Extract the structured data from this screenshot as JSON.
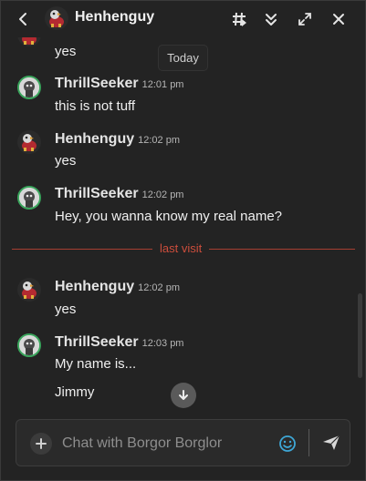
{
  "header": {
    "title": "Henhenguy",
    "back_icon": "chevron-left-icon",
    "actions": [
      "threads-icon",
      "double-chevron-down-icon",
      "expand-icon",
      "close-icon"
    ]
  },
  "date_marker": "Today",
  "top_partial_message": {
    "text": "yes"
  },
  "messages": [
    {
      "author": "ThrillSeeker",
      "time": "12:01 pm",
      "lines": [
        "this is not tuff"
      ]
    },
    {
      "author": "Henhenguy",
      "time": "12:02 pm",
      "lines": [
        "yes"
      ]
    },
    {
      "author": "ThrillSeeker",
      "time": "12:02 pm",
      "lines": [
        "Hey, you wanna know my real name?"
      ]
    },
    {
      "author": "Henhenguy",
      "time": "12:02 pm",
      "lines": [
        "yes"
      ]
    },
    {
      "author": "ThrillSeeker",
      "time": "12:03 pm",
      "lines": [
        "My name is...",
        "Jimmy"
      ]
    }
  ],
  "divider_label": "last visit",
  "composer": {
    "placeholder": "Chat with Borgor Borglor"
  },
  "colors": {
    "accent_divider": "#cc4d3c",
    "online_ring": "#3aa55c",
    "emoji": "#3ea7d6"
  }
}
